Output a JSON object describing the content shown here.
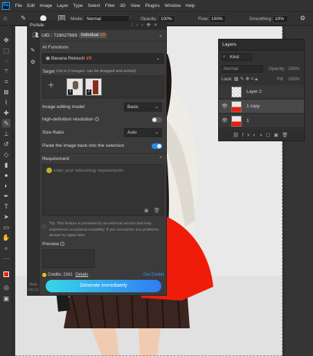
{
  "menubar": {
    "items": [
      "File",
      "Edit",
      "Image",
      "Layer",
      "Type",
      "Select",
      "Filter",
      "3D",
      "View",
      "Plugins",
      "Window",
      "Help"
    ]
  },
  "options": {
    "mode_label": "Mode:",
    "mode_value": "Normal",
    "opacity_label": "Opacity:",
    "opacity_value": "100%",
    "flow_label": "Flow:",
    "flow_value": "100%",
    "smoothing_label": "Smoothing:",
    "smoothing_value": "10%"
  },
  "panel": {
    "title": "PsAide",
    "uid": "UID : 719027993",
    "plan": "Individual",
    "plan_badge": "V3",
    "ai_functions_label": "AI Functions",
    "function_value": "Banana Retouch",
    "function_badge": "V3",
    "target_label": "Target",
    "target_hint": "(Up to 5 images, can be dragged and sorted)",
    "thumb1_num": "1",
    "thumb2_num": "2",
    "model_label": "Image editing model",
    "model_value": "Basic",
    "hd_label": "high-definition resolution",
    "ratio_label": "Size Ratio",
    "ratio_value": "Auto",
    "paste_label": "Paste the image back into the selection",
    "requirement_label": "Requirement",
    "requirement_placeholder": "enter your retouching requirements",
    "tip": "Tip: This feature is provided by an external service and may experience occasional instability. If you encounter any problems, please try again later.",
    "preview_label": "Preview",
    "credits_text": "Credits: 2161",
    "details_link": "Details",
    "get_credits": "Get Credits",
    "generate_label": "Generate immediately",
    "beta": "Beta",
    "version": "V.B.1.0"
  },
  "layers": {
    "title": "Layers",
    "kind_label": "Kind",
    "blend": "Normal",
    "opacity_label": "Opacity:",
    "opacity_value": "100%",
    "lock_label": "Lock:",
    "fill_label": "Fill:",
    "fill_value": "100%",
    "items": [
      {
        "name": "Layer 2"
      },
      {
        "name": "1 copy"
      },
      {
        "name": "1"
      }
    ]
  },
  "colors": {
    "accent": "#2f7df2",
    "bag": "#f01c0a",
    "toggle_on": "#2b8cf0"
  }
}
